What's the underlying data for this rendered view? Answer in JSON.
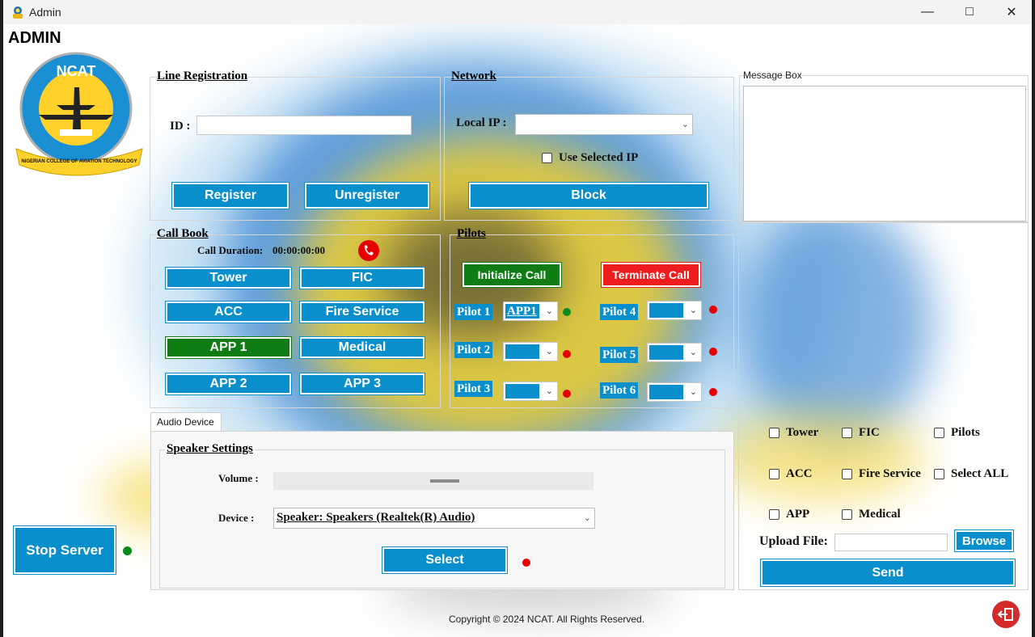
{
  "window": {
    "title": "Admin",
    "minimize_icon": "minimize-icon",
    "maximize_icon": "maximize-icon",
    "close_icon": "close-icon"
  },
  "header": {
    "title": "ADMIN"
  },
  "logo": {
    "ring_text": "NCAT",
    "banner_text": "NIGERIAN COLLEGE OF AVIATION TECHNOLOGY"
  },
  "line_registration": {
    "label": "Line Registration",
    "id_label": "ID :",
    "id_value": "",
    "register": "Register",
    "unregister": "Unregister"
  },
  "network": {
    "label": "Network",
    "local_ip_label": "Local IP :",
    "local_ip_value": "",
    "use_selected_ip": "Use Selected IP",
    "block": "Block"
  },
  "message_box": {
    "label": "Message Box",
    "value": ""
  },
  "call_book": {
    "label": "Call Book",
    "duration_label": "Call Duration:",
    "duration_value": "00:00:00:00",
    "buttons": [
      "Tower",
      "FIC",
      "ACC",
      "Fire Service",
      "APP 1",
      "Medical",
      "APP 2",
      "APP 3"
    ],
    "active": "APP 1"
  },
  "pilots": {
    "label": "Pilots",
    "initialize": "Initialize Call",
    "terminate": "Terminate Call",
    "rows": [
      {
        "name": "Pilot 1",
        "value": "APP1",
        "status": "online"
      },
      {
        "name": "Pilot 2",
        "value": "",
        "status": "offline"
      },
      {
        "name": "Pilot 3",
        "value": "",
        "status": "offline"
      },
      {
        "name": "Pilot 4",
        "value": "",
        "status": "offline"
      },
      {
        "name": "Pilot 5",
        "value": "",
        "status": "offline"
      },
      {
        "name": "Pilot 6",
        "value": "",
        "status": "offline"
      }
    ]
  },
  "audio": {
    "tab": "Audio Device",
    "group": "Speaker Settings",
    "volume_label": "Volume :",
    "device_label": "Device :",
    "device_value": "Speaker: Speakers (Realtek(R) Audio)",
    "select": "Select"
  },
  "broadcast": {
    "checkboxes": [
      "Tower",
      "FIC",
      "Pilots",
      "ACC",
      "Fire Service",
      "Select ALL",
      "APP",
      "Medical"
    ],
    "upload_label": "Upload File:",
    "upload_value": "",
    "browse": "Browse",
    "send": "Send"
  },
  "server": {
    "stop": "Stop Server",
    "status": "running"
  },
  "footer": {
    "copyright": "Copyright © 2024 NCAT. All Rights Reserved."
  },
  "colors": {
    "accent": "#0a8fcd",
    "success": "#0f7d14",
    "danger": "#ee1c1c",
    "status_online": "#0a8a1c",
    "status_offline": "#e60000"
  },
  "icons": {
    "phone": "phone-icon",
    "logout": "logout-icon",
    "app": "admin-app-icon"
  }
}
